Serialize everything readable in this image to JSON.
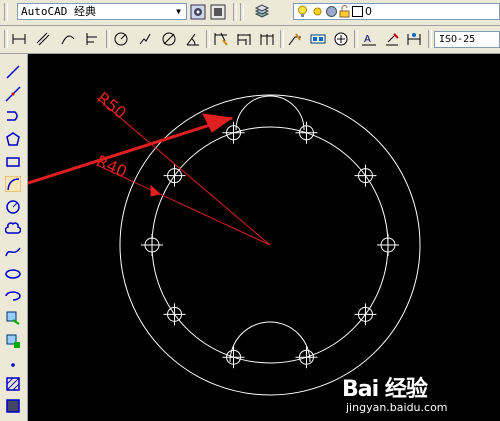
{
  "toolbar_top": {
    "workspace": "AutoCAD 经典",
    "layer_name": "0",
    "layer_icons": [
      "lightbulb-icon",
      "sun-icon",
      "color-square-icon"
    ]
  },
  "toolbar_dim": {
    "dim_style": "ISO-25",
    "icons": [
      "linear-dim-icon",
      "aligned-dim-icon",
      "arc-length-icon",
      "ordinate-dim-icon",
      "radius-dim-icon",
      "jogged-dim-icon",
      "diameter-dim-icon",
      "angular-dim-icon",
      "quick-dim-icon",
      "baseline-dim-icon",
      "continue-dim-icon",
      "quick-leader-icon",
      "tolerance-icon",
      "center-mark-icon",
      "dimedit-icon",
      "dimtedit-icon",
      "dim-update-icon"
    ]
  },
  "left_toolbar": {
    "tools": [
      "line-icon",
      "construction-line-icon",
      "polyline-icon",
      "polygon-icon",
      "rectangle-icon",
      "arc-icon",
      "circle-icon",
      "revcloud-icon",
      "spline-icon",
      "ellipse-icon",
      "ellipse-arc-icon",
      "insert-block-icon",
      "make-block-icon",
      "point-icon",
      "hatch-icon",
      "gradient-icon"
    ]
  },
  "drawing": {
    "dim_labels": [
      "R50",
      "R40"
    ],
    "colors": {
      "geometry": "#ffffff",
      "annotation": "#ff2020",
      "background": "#000000"
    }
  },
  "watermark": {
    "brand": "Bai 经验",
    "url": "jingyan.baidu.com"
  }
}
